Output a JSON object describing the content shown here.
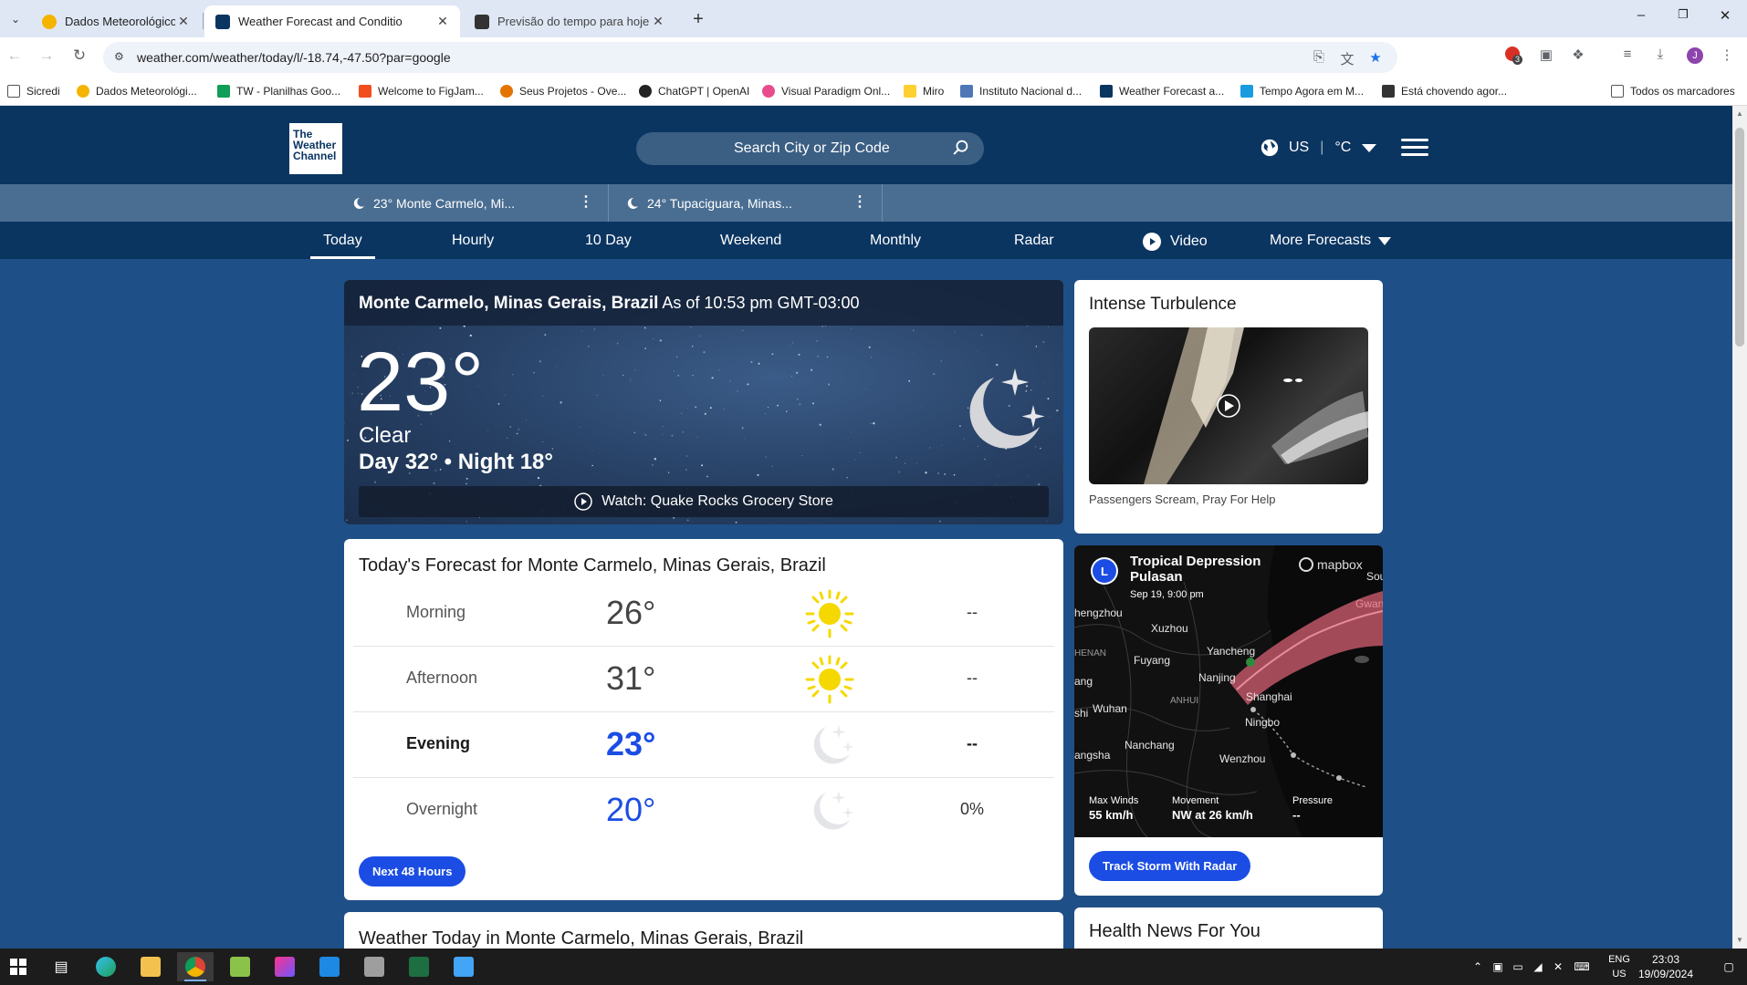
{
  "browser": {
    "tabs": [
      {
        "title": "Dados Meteorológicos",
        "active": false
      },
      {
        "title": "Weather Forecast and Conditio",
        "active": true
      },
      {
        "title": "Previsão do tempo para hoje er",
        "active": false
      }
    ],
    "url": "weather.com/weather/today/l/-18.74,-47.50?par=google",
    "extension_badge": "3",
    "profile_initial": "J",
    "bookmarks": [
      "Sicredi",
      "Dados Meteorológi...",
      "TW - Planilhas Goo...",
      "Welcome to FigJam...",
      "Seus Projetos - Ove...",
      "ChatGPT | OpenAI",
      "Visual Paradigm Onl...",
      "Miro",
      "Instituto Nacional d...",
      "Weather Forecast a...",
      "Tempo Agora em M...",
      "Está chovendo agor..."
    ],
    "all_bookmarks": "Todos os marcadores"
  },
  "header": {
    "logo_lines": [
      "The",
      "Weather",
      "Channel"
    ],
    "search_placeholder": "Search City or Zip Code",
    "region": "US",
    "unit": "°C"
  },
  "recent_locations": [
    {
      "label": "23° Monte Carmelo, Mi..."
    },
    {
      "label": "24° Tupaciguara, Minas..."
    }
  ],
  "subnav": {
    "items": [
      "Today",
      "Hourly",
      "10 Day",
      "Weekend",
      "Monthly",
      "Radar",
      "Video",
      "More Forecasts"
    ],
    "active": "Today"
  },
  "current": {
    "location": "Monte Carmelo, Minas Gerais, Brazil",
    "as_of": "As of 10:53 pm GMT-03:00",
    "temp": "23°",
    "phrase": "Clear",
    "day_night": "Day 32° • Night 18°",
    "watch_label": "Watch:",
    "watch_title": "Quake Rocks Grocery Store"
  },
  "today_forecast": {
    "title": "Today's Forecast for Monte Carmelo, Minas Gerais, Brazil",
    "rows": [
      {
        "period": "Morning",
        "temp": "26°",
        "icon": "sun-icon",
        "precip": "--"
      },
      {
        "period": "Afternoon",
        "temp": "31°",
        "icon": "sun-icon",
        "precip": "--"
      },
      {
        "period": "Evening",
        "temp": "23°",
        "icon": "moon-icon",
        "precip": "--"
      },
      {
        "period": "Overnight",
        "temp": "20°",
        "icon": "moon-icon",
        "precip": "0%"
      }
    ],
    "button": "Next 48 Hours"
  },
  "weather_today_title": "Weather Today in Monte Carmelo, Minas Gerais, Brazil",
  "video_card": {
    "title": "Intense Turbulence",
    "caption": "Passengers Scream, Pray For Help"
  },
  "storm_card": {
    "badge": "L",
    "name_line1": "Tropical Depression",
    "name_line2": "Pulasan",
    "time": "Sep 19, 9:00 pm",
    "brand": "mapbox",
    "places": [
      "Sou",
      "hengzhou",
      "Gwang",
      "Xuzhou",
      "HENAN",
      "Yancheng",
      "Fuyang",
      "ang",
      "Nanjing",
      "ANHUI",
      "Shanghai",
      "Wuhan",
      "shi",
      "Ningbo",
      "Nanchang",
      "angsha",
      "Wenzhou"
    ],
    "max_winds_label": "Max Winds",
    "max_winds": "55 km/h",
    "movement_label": "Movement",
    "movement": "NW at 26 km/h",
    "pressure_label": "Pressure",
    "pressure": "--",
    "button": "Track Storm With Radar"
  },
  "health_title": "Health News For You",
  "taskbar": {
    "lang_line1": "ENG",
    "lang_line2": "US",
    "time": "23:03",
    "date": "19/09/2024"
  },
  "colors": {
    "brand_dark": "#0b3561",
    "page_bg": "#1f4f87",
    "accent_blue": "#1b4de4",
    "sun_yellow": "#f5d800"
  }
}
